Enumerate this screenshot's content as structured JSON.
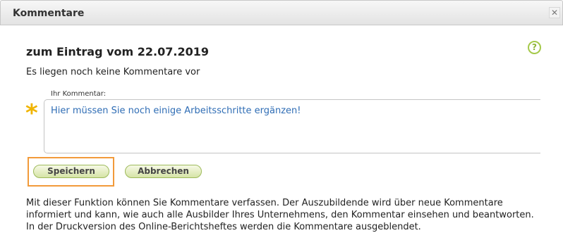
{
  "dialog": {
    "title": "Kommentare",
    "close_symbol": "✕"
  },
  "help_icon": {
    "symbol": "?"
  },
  "entry": {
    "heading": "zum Eintrag vom 22.07.2019",
    "no_comments_text": "Es liegen noch keine Kommentare vor"
  },
  "comment_field": {
    "label": "Ihr Kommentar:",
    "required_symbol": "*",
    "value": "Hier müssen Sie noch einige Arbeitsschritte ergänzen!"
  },
  "buttons": {
    "save_label": "Speichern",
    "cancel_label": "Abbrechen"
  },
  "description": "Mit dieser Funktion können Sie Kommentare verfassen. Der Auszubildende wird über neue Kommentare informiert und kann, wie auch alle Ausbilder Ihres Unternehmens, den Kommentar einsehen und beantworten. In der Druckversion des Online-Berichtsheftes werden die Kommentare ausgeblendet.",
  "colors": {
    "accent_green": "#a5c94a",
    "highlight_orange": "#f29a3a",
    "required_star": "#f0b400",
    "comment_text": "#2f6db5"
  },
  "icons": {
    "close": "close-icon",
    "help": "help-icon",
    "required": "required-star-icon"
  }
}
